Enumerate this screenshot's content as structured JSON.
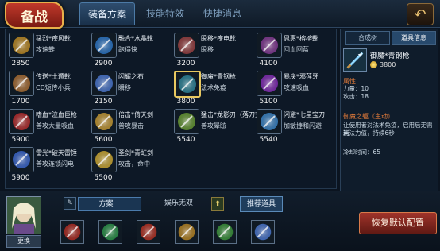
{
  "header": {
    "badge": "备战",
    "tabs": [
      {
        "label": "装备方案",
        "active": true
      },
      {
        "label": "技能特效",
        "active": false
      },
      {
        "label": "快捷消息",
        "active": false
      }
    ],
    "back_icon": "return-arrow-icon"
  },
  "items": [
    {
      "name": "猛烈*疾风靴",
      "desc": "攻速鞋",
      "price": "2850",
      "color": "#c89020"
    },
    {
      "name": "融合*水晶靴",
      "desc": "跑得快",
      "price": "2900",
      "color": "#2a7ad0"
    },
    {
      "name": "瞬移*疾电靴",
      "desc": "瞬移",
      "price": "3200",
      "color": "#a04040"
    },
    {
      "name": "恩惠*榕榕靴",
      "desc": "回血回蓝",
      "price": "4100",
      "color": "#8a3a9a"
    },
    {
      "name": "传送*土遁靴",
      "desc": "CD短传小兵",
      "price": "1700",
      "color": "#b07030"
    },
    {
      "name": "闪耀之石",
      "desc": "瞬移",
      "price": "2150",
      "color": "#4a7ad8"
    },
    {
      "name": "御魔*青钢枪",
      "desc": "法术免疫",
      "price": "3800",
      "color": "#2a8aa0",
      "selected": true
    },
    {
      "name": "暴戾*邪莲牙",
      "desc": "攻速吸血",
      "price": "5100",
      "color": "#8a2ac0"
    },
    {
      "name": "嗜血*泣血巨枪",
      "desc": "普攻大量吸血",
      "price": "5900",
      "color": "#c02a2a"
    },
    {
      "name": "倍击*倚天剑",
      "desc": "普攻暴击",
      "price": "5600",
      "color": "#d0a030"
    },
    {
      "name": "猛击*龙影刃（落刀式）",
      "desc": "普攻晕眩",
      "price": "5540",
      "color": "#6aa030"
    },
    {
      "name": "闪避*七星宝刀",
      "desc": "加敏捷和闪避",
      "price": "5540",
      "color": "#3a8ad0"
    },
    {
      "name": "雷光*破天雷锤",
      "desc": "普攻连锁闪电",
      "price": "5900",
      "color": "#3a6ad8"
    },
    {
      "name": "圣剑*青虹剑",
      "desc": "攻击，命中",
      "price": "5500",
      "color": "#d8b030"
    }
  ],
  "panel": {
    "tabs": [
      {
        "label": "合成树",
        "active": false
      },
      {
        "label": "道具信息",
        "active": true
      }
    ],
    "item_name": "御魔*青钢枪",
    "item_price": "3800",
    "attr_title": "属性",
    "attrs": [
      "力量：10",
      "攻击：18"
    ],
    "skill_title": "御魔之躯（主动）",
    "skill_desc": [
      "让使用者对法术免疫，启用后无需消",
      "耗法力值，持续6秒"
    ],
    "cooldown": "冷却时间：65"
  },
  "bottom": {
    "swap_label": "更换",
    "plan_label": "方案一",
    "plan2_label": "娱乐无双",
    "recommend_label": "推荐道具",
    "restore_label": "恢复默认配置",
    "slots": [
      "#b82a20",
      "#2a9a4a",
      "#c03020",
      "#c08a20",
      "#3a9a3a",
      "#4a7ad8"
    ]
  }
}
